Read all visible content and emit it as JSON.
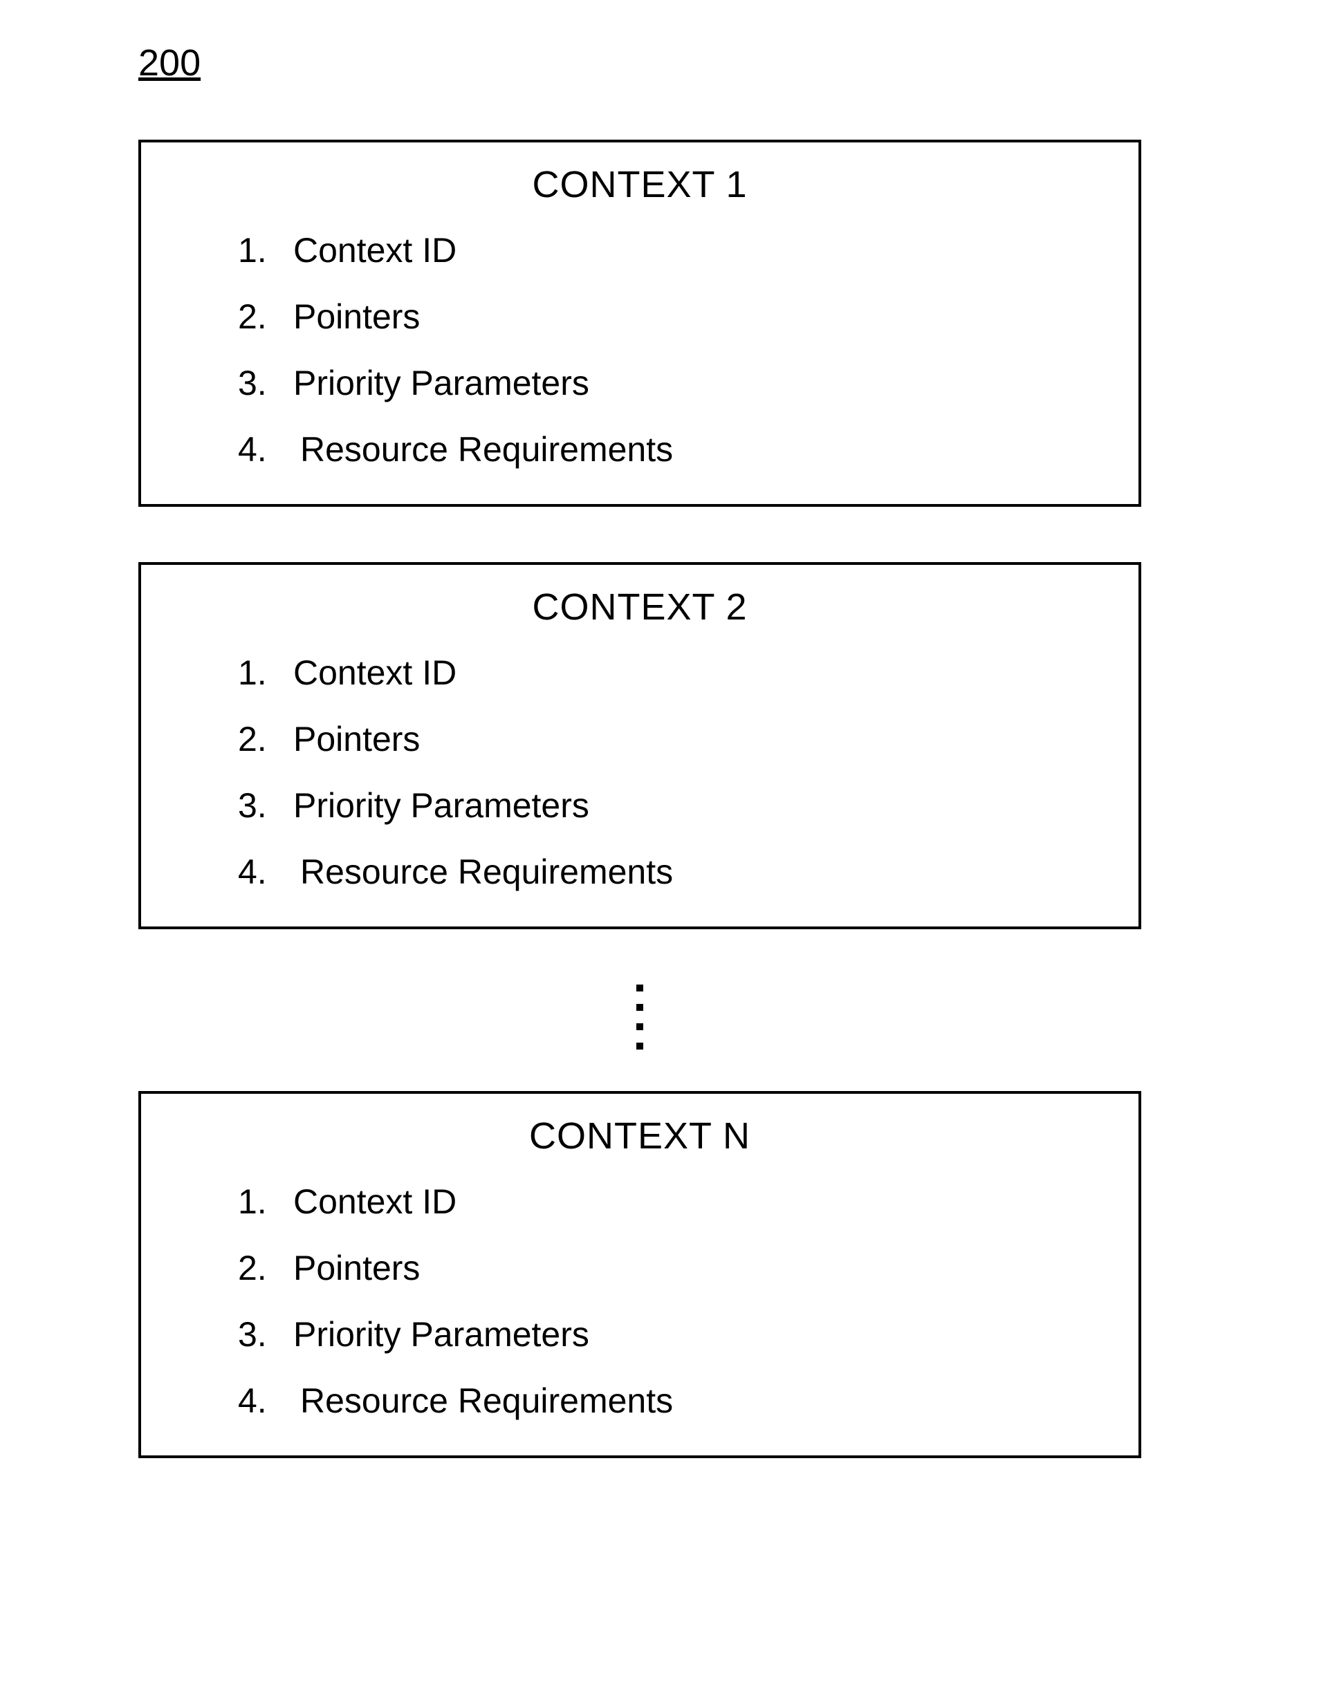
{
  "figure_label": "200",
  "contexts": [
    {
      "title": "CONTEXT 1",
      "items": [
        {
          "num": "1.",
          "text": "Context ID",
          "extra": false
        },
        {
          "num": "2.",
          "text": "Pointers",
          "extra": false
        },
        {
          "num": "3.",
          "text": "Priority Parameters",
          "extra": false
        },
        {
          "num": "4.",
          "text": "Resource Requirements",
          "extra": true
        }
      ]
    },
    {
      "title": "CONTEXT 2",
      "items": [
        {
          "num": "1.",
          "text": "Context ID",
          "extra": false
        },
        {
          "num": "2.",
          "text": "Pointers",
          "extra": false
        },
        {
          "num": "3.",
          "text": "Priority Parameters",
          "extra": false
        },
        {
          "num": "4.",
          "text": "Resource Requirements",
          "extra": true
        }
      ]
    },
    {
      "title": "CONTEXT N",
      "items": [
        {
          "num": "1.",
          "text": "Context ID",
          "extra": false
        },
        {
          "num": "2.",
          "text": "Pointers",
          "extra": false
        },
        {
          "num": "3.",
          "text": "Priority Parameters",
          "extra": false
        },
        {
          "num": "4.",
          "text": "Resource Requirements",
          "extra": true
        }
      ]
    }
  ]
}
